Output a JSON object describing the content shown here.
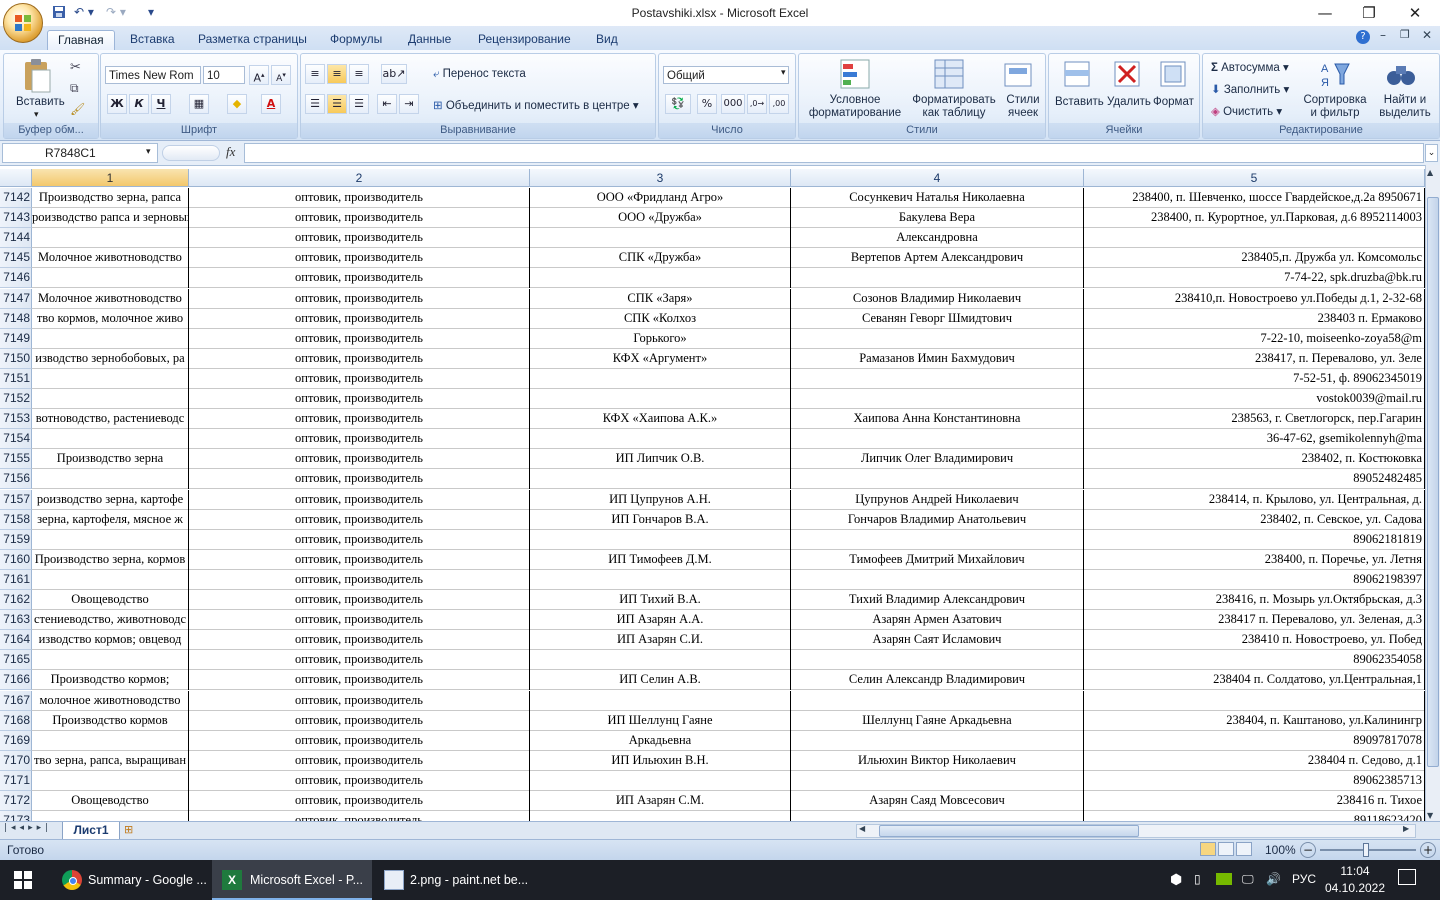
{
  "window": {
    "title": "Postavshiki.xlsx - Microsoft Excel",
    "minimize": "—",
    "restore": "❐",
    "close": "✕"
  },
  "ribbon": {
    "tabs": [
      "Главная",
      "Вставка",
      "Разметка страницы",
      "Формулы",
      "Данные",
      "Рецензирование",
      "Вид"
    ],
    "clipboard": {
      "paste": "Вставить",
      "group": "Буфер обм..."
    },
    "font": {
      "name": "Times New Rom",
      "size": "10",
      "group": "Шрифт",
      "bold": "Ж",
      "italic": "К",
      "underline": "Ч"
    },
    "alignment": {
      "wrap": "Перенос текста",
      "merge": "Объединить и поместить в центре",
      "group": "Выравнивание"
    },
    "number": {
      "format": "Общий",
      "group": "Число",
      "percent": "%",
      "thousands": "000"
    },
    "styles": {
      "conditional": "Условное форматирование",
      "as_table": "Форматировать как таблицу",
      "cell_styles": "Стили ячеек",
      "group": "Стили"
    },
    "cells": {
      "insert": "Вставить",
      "delete": "Удалить",
      "format": "Формат",
      "group": "Ячейки"
    },
    "editing": {
      "autosum": "Автосумма",
      "fill": "Заполнить",
      "clear": "Очистить",
      "sort": "Сортировка и фильтр",
      "find": "Найти и выделить",
      "group": "Редактирование"
    }
  },
  "formula_bar": {
    "name_box": "R7848C1",
    "fx": "fx"
  },
  "sheet": {
    "columns": [
      "1",
      "2",
      "3",
      "4",
      "5"
    ],
    "rows": [
      {
        "n": "7142",
        "c": [
          "Производство зерна, рапса",
          "оптовик, производитель",
          "ООО «Фридланд Агро»",
          "Сосункевич Наталья Николаевна",
          "238400, п. Шевченко, шоссе Гвардейское,д.2а 8950671"
        ]
      },
      {
        "n": "7143",
        "c": [
          "роизводство рапса и зерновых",
          "оптовик, производитель",
          "ООО «Дружба»",
          "Бакулева Вера",
          "238400,  п. Курортное, ул.Парковая, д.6 8952114003"
        ]
      },
      {
        "n": "7144",
        "c": [
          "",
          "оптовик, производитель",
          "",
          "Александровна",
          ""
        ]
      },
      {
        "n": "7145",
        "c": [
          "Молочное животноводство",
          "оптовик, производитель",
          "СПК «Дружба»",
          "Вертепов Артем Александрович",
          "238405,п. Дружба ул. Комсомольс"
        ]
      },
      {
        "n": "7146",
        "c": [
          "",
          "оптовик, производитель",
          "",
          "",
          "7-74-22, spk.druzba@bk.ru"
        ]
      },
      {
        "n": "7147",
        "c": [
          "Молочное животноводство",
          "оптовик, производитель",
          "СПК «Заря»",
          "Созонов Владимир Николаевич",
          "238410,п. Новостроево ул.Победы д.1, 2-32-68"
        ]
      },
      {
        "n": "7148",
        "c": [
          "тво кормов, молочное живо",
          "оптовик, производитель",
          "СПК «Колхоз",
          "Севанян Геворг Шмидтович",
          "238403 п. Ермаково"
        ]
      },
      {
        "n": "7149",
        "c": [
          "",
          "оптовик, производитель",
          "Горького»",
          "",
          "7-22-10, moiseenko-zoya58@m"
        ]
      },
      {
        "n": "7150",
        "c": [
          "изводство зернобобовых, ра",
          "оптовик, производитель",
          "КФХ «Аргумент»",
          "Рамазанов Имин Бахмудович",
          "238417, п. Перевалово, ул. Зеле"
        ]
      },
      {
        "n": "7151",
        "c": [
          "",
          "оптовик, производитель",
          "",
          "",
          "7-52-51, ф. 89062345019"
        ]
      },
      {
        "n": "7152",
        "c": [
          "",
          "оптовик, производитель",
          "",
          "",
          "vostok0039@mail.ru"
        ]
      },
      {
        "n": "7153",
        "c": [
          "вотноводство, растениеводс",
          "оптовик, производитель",
          "КФХ «Хаипова А.К.»",
          "Хаипова Анна Константиновна",
          "238563, г. Светлогорск, пер.Гагарин"
        ]
      },
      {
        "n": "7154",
        "c": [
          "",
          "оптовик, производитель",
          "",
          "",
          "36-47-62, gsemikolennyh@ma"
        ]
      },
      {
        "n": "7155",
        "c": [
          "Производство зерна",
          "оптовик, производитель",
          "ИП Липчик О.В.",
          "Липчик Олег Владимирович",
          "238402, п. Костюковка"
        ]
      },
      {
        "n": "7156",
        "c": [
          "",
          "оптовик, производитель",
          "",
          "",
          "89052482485"
        ]
      },
      {
        "n": "7157",
        "c": [
          "роизводство зерна, картофе",
          "оптовик, производитель",
          "ИП Цупрунов А.Н.",
          "Цупрунов Андрей Николаевич",
          "238414, п. Крылово, ул. Центральная, д."
        ]
      },
      {
        "n": "7158",
        "c": [
          "зерна, картофеля, мясное ж",
          "оптовик, производитель",
          "ИП Гончаров В.А.",
          "Гончаров Владимир Анатольевич",
          "238402, п. Севское, ул. Садова"
        ]
      },
      {
        "n": "7159",
        "c": [
          "",
          "оптовик, производитель",
          "",
          "",
          "89062181819"
        ]
      },
      {
        "n": "7160",
        "c": [
          "Производство зерна, кормов",
          "оптовик, производитель",
          "ИП Тимофеев Д.М.",
          "Тимофеев Дмитрий Михайлович",
          "238400, п. Поречье, ул. Летня"
        ]
      },
      {
        "n": "7161",
        "c": [
          "",
          "оптовик, производитель",
          "",
          "",
          "89062198397"
        ]
      },
      {
        "n": "7162",
        "c": [
          "Овощеводство",
          "оптовик, производитель",
          "ИП Тихий В.А.",
          "Тихий Владимир Александрович",
          "238416, п. Мозырь ул.Октябрьская, д.3"
        ]
      },
      {
        "n": "7163",
        "c": [
          "стениеводство, животноводс",
          "оптовик, производитель",
          "ИП Азарян А.А.",
          "Азарян Армен Азатович",
          "238417 п. Перевалово, ул. Зеленая, д.3"
        ]
      },
      {
        "n": "7164",
        "c": [
          "изводство кормов; овцевод",
          "оптовик, производитель",
          "ИП Азарян С.И.",
          "Азарян Саят Исламович",
          "238410 п. Новостроево, ул. Побед"
        ]
      },
      {
        "n": "7165",
        "c": [
          "",
          "оптовик, производитель",
          "",
          "",
          "89062354058"
        ]
      },
      {
        "n": "7166",
        "c": [
          "Производство кормов;",
          "оптовик, производитель",
          "ИП Селин А.В.",
          "Селин Александр Владимирович",
          "238404 п. Солдатово, ул.Центральная,1"
        ]
      },
      {
        "n": "7167",
        "c": [
          "молочное животноводство",
          "оптовик, производитель",
          "",
          "",
          ""
        ]
      },
      {
        "n": "7168",
        "c": [
          "Производство кормов",
          "оптовик, производитель",
          "ИП Шеллунц Гаяне",
          "Шеллунц Гаяне Аркадьевна",
          "238404, п. Каштаново, ул.Калинингр"
        ]
      },
      {
        "n": "7169",
        "c": [
          "",
          "оптовик, производитель",
          "Аркадьевна",
          "",
          "89097817078"
        ]
      },
      {
        "n": "7170",
        "c": [
          "тво зерна, рапса, выращиван",
          "оптовик, производитель",
          "ИП Ильюхин В.Н.",
          "Ильюхин Виктор Николаевич",
          "238404 п. Седово, д.1"
        ]
      },
      {
        "n": "7171",
        "c": [
          "",
          "оптовик, производитель",
          "",
          "",
          "89062385713"
        ]
      },
      {
        "n": "7172",
        "c": [
          "Овощеводство",
          "оптовик, производитель",
          "ИП Азарян С.М.",
          "Азарян Саяд Мовсесович",
          "238416 п. Тихое"
        ]
      },
      {
        "n": "7173",
        "c": [
          "",
          "оптовик, производитель",
          "",
          "",
          "89118623420"
        ]
      }
    ],
    "sheet_tab": "Лист1"
  },
  "status": {
    "ready": "Готово",
    "zoom": "100%"
  },
  "taskbar": {
    "items": [
      "Summary - Google ...",
      "Microsoft Excel - P...",
      "2.png - paint.net be..."
    ],
    "lang": "РУС",
    "time": "11:04",
    "date": "04.10.2022"
  }
}
